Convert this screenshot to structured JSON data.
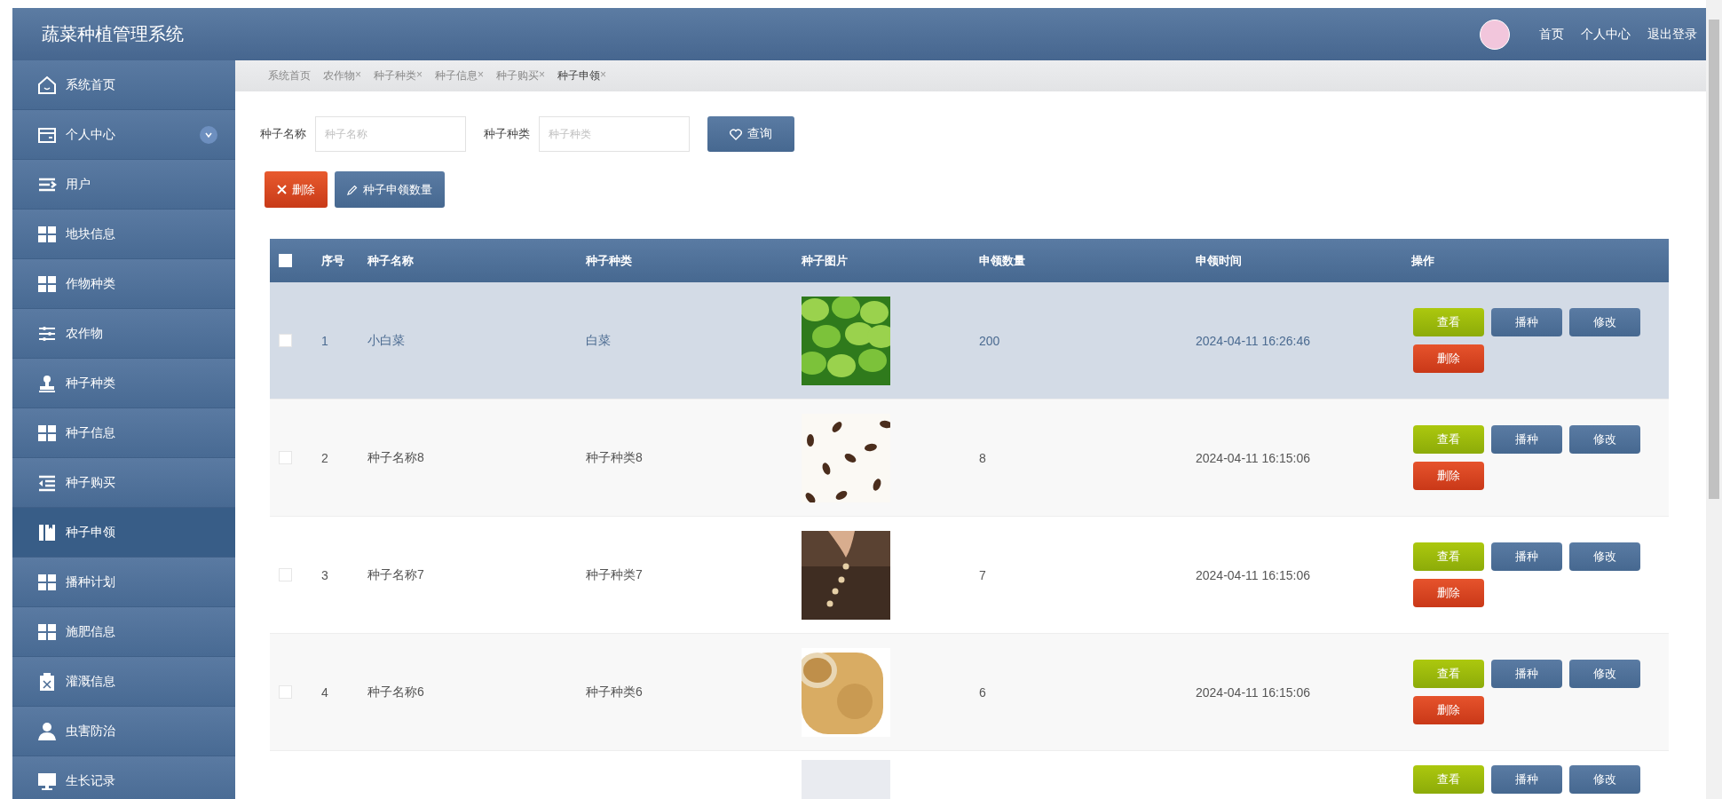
{
  "header": {
    "title": "蔬菜种植管理系统",
    "links": [
      "首页",
      "个人中心",
      "退出登录"
    ]
  },
  "sidebar": {
    "items": [
      {
        "label": "系统首页",
        "selected": false
      },
      {
        "label": "个人中心",
        "selected": false,
        "expanded": false
      },
      {
        "label": "用户",
        "selected": false
      },
      {
        "label": "地块信息",
        "selected": false
      },
      {
        "label": "作物种类",
        "selected": false
      },
      {
        "label": "农作物",
        "selected": false
      },
      {
        "label": "种子种类",
        "selected": false
      },
      {
        "label": "种子信息",
        "selected": false
      },
      {
        "label": "种子购买",
        "selected": false
      },
      {
        "label": "种子申领",
        "selected": true
      },
      {
        "label": "播种计划",
        "selected": false
      },
      {
        "label": "施肥信息",
        "selected": false
      },
      {
        "label": "灌溉信息",
        "selected": false
      },
      {
        "label": "虫害防治",
        "selected": false
      },
      {
        "label": "生长记录",
        "selected": false
      }
    ]
  },
  "breadcrumb": [
    {
      "label": "系统首页",
      "closable": false,
      "selected": false
    },
    {
      "label": "农作物",
      "closable": true,
      "selected": false
    },
    {
      "label": "种子种类",
      "closable": true,
      "selected": false
    },
    {
      "label": "种子信息",
      "closable": true,
      "selected": false
    },
    {
      "label": "种子购买",
      "closable": true,
      "selected": false
    },
    {
      "label": "种子申领",
      "closable": true,
      "selected": true
    }
  ],
  "close_mark": "×",
  "search": {
    "fields": [
      {
        "label": "种子名称",
        "placeholder": "种子名称"
      },
      {
        "label": "种子种类",
        "placeholder": "种子种类"
      }
    ],
    "button": "查询"
  },
  "toolbar": [
    {
      "kind": "delete",
      "label": "删除"
    },
    {
      "kind": "edit",
      "label": "种子申领数量"
    }
  ],
  "table": {
    "select_all_checked": false,
    "columns": [
      "序号",
      "种子名称",
      "种子种类",
      "种子图片",
      "申领数量",
      "申领时间",
      "操作"
    ],
    "rows": [
      {
        "selected": true,
        "checked": false,
        "index": "1",
        "name": "小白菜",
        "type": "白菜",
        "image": {
          "kind": "picture"
        },
        "quantity": "200",
        "time": "2024-04-11 16:26:46",
        "actions": [
          "查看",
          "播种",
          "修改",
          "删除"
        ]
      },
      {
        "selected": false,
        "checked": false,
        "index": "2",
        "name": "种子名称8",
        "type": "种子种类8",
        "image": {
          "kind": "picture"
        },
        "quantity": "8",
        "time": "2024-04-11 16:15:06",
        "actions": [
          "查看",
          "播种",
          "修改",
          "删除"
        ]
      },
      {
        "selected": false,
        "checked": false,
        "index": "3",
        "name": "种子名称7",
        "type": "种子种类7",
        "image": {
          "kind": "picture"
        },
        "quantity": "7",
        "time": "2024-04-11 16:15:06",
        "actions": [
          "查看",
          "播种",
          "修改",
          "删除"
        ]
      },
      {
        "selected": false,
        "checked": false,
        "index": "4",
        "name": "种子名称6",
        "type": "种子种类6",
        "image": {
          "kind": "picture"
        },
        "quantity": "6",
        "time": "2024-04-11 16:15:06",
        "actions": [
          "查看",
          "播种",
          "修改",
          "删除"
        ]
      },
      {
        "selected": false,
        "image": {
          "kind": "picture"
        },
        "actions": [
          "查看",
          "播种",
          "修改"
        ]
      }
    ]
  }
}
